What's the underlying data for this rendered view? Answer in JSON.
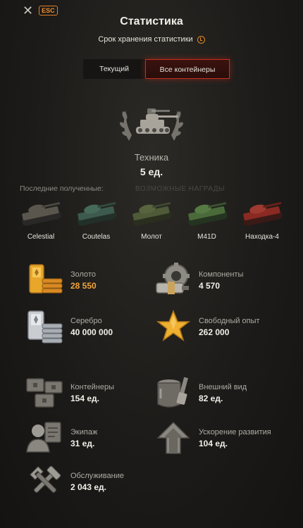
{
  "header": {
    "esc_label": "ESC",
    "title": "Статистика",
    "subtitle": "Срок хранения статистики"
  },
  "tabs": [
    {
      "label": "Текущий",
      "active": false
    },
    {
      "label": "Все контейнеры",
      "active": true
    }
  ],
  "vehicles": {
    "label": "Техника",
    "count": "5 ед.",
    "recent_label": "Последние полученные:",
    "ghost_text": "ВОЗМОЖНЫЕ НАГРАДЫ",
    "items": [
      {
        "name": "Celestial",
        "color": "#5a564e"
      },
      {
        "name": "Coutelas",
        "color": "#3d5a4e"
      },
      {
        "name": "Молот",
        "color": "#4e5a38"
      },
      {
        "name": "M41D",
        "color": "#4a6a3a"
      },
      {
        "name": "Находка-4",
        "color": "#8a2a22"
      }
    ]
  },
  "resources": [
    {
      "label": "Золото",
      "value": "28 550",
      "icon": "gold-bars-icon",
      "value_color": "#f2a43a"
    },
    {
      "label": "Компоненты",
      "value": "4 570",
      "icon": "components-icon"
    },
    {
      "label": "Серебро",
      "value": "40 000 000",
      "icon": "silver-bars-icon"
    },
    {
      "label": "Свободный опыт",
      "value": "262 000",
      "icon": "star-icon"
    }
  ],
  "items": [
    {
      "label": "Контейнеры",
      "value": "154 ед.",
      "icon": "containers-icon"
    },
    {
      "label": "Внешний вид",
      "value": "82 ед.",
      "icon": "paint-brush-icon"
    },
    {
      "label": "Экипаж",
      "value": "31 ед.",
      "icon": "crew-icon"
    },
    {
      "label": "Ускорение развития",
      "value": "104 ед.",
      "icon": "upgrade-arrow-icon"
    },
    {
      "label": "Обслуживание",
      "value": "2 043 ед.",
      "icon": "wrench-hammer-icon"
    }
  ],
  "colors": {
    "accent": "#e0802a",
    "gold": "#f2a43a",
    "active_tab_border": "#c0301e"
  }
}
